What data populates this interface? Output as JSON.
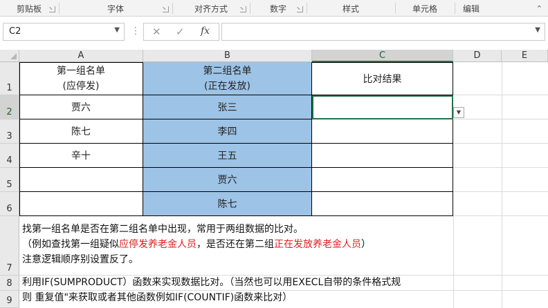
{
  "ribbon": {
    "groups": [
      {
        "label": "剪贴板",
        "launcher": true
      },
      {
        "label": "字体",
        "launcher": true
      },
      {
        "label": "对齐方式",
        "launcher": true
      },
      {
        "label": "数字",
        "launcher": true
      },
      {
        "label": "样式",
        "launcher": false
      },
      {
        "label": "单元格",
        "launcher": false
      },
      {
        "label": "编辑",
        "launcher": false
      }
    ],
    "collapse_icon": "chevron-up-icon"
  },
  "formula_bar": {
    "name_box": "C2",
    "cancel_glyph": "✕",
    "enter_glyph": "✓",
    "fx_glyph": "fx",
    "formula_value": ""
  },
  "sheet": {
    "columns": [
      "A",
      "B",
      "C",
      "D",
      "E"
    ],
    "selected_column": "C",
    "selected_row": "2",
    "rows": [
      "1",
      "2",
      "3",
      "4",
      "5",
      "6",
      "7",
      "8",
      "9"
    ],
    "header": {
      "a_line1": "第一组名单",
      "a_line2": "(应停发)",
      "b_line1": "第二组名单",
      "b_line2": "(正在发放)",
      "c": "比对结果"
    },
    "col_a_values": [
      "贾六",
      "陈七",
      "辛十",
      "",
      ""
    ],
    "col_b_values": [
      "张三",
      "李四",
      "王五",
      "贾六",
      "陈七"
    ],
    "col_c_values": [
      "",
      "",
      "",
      "",
      ""
    ],
    "blue_fill": "#9dc3e6",
    "accent": "#217346"
  },
  "notes": {
    "row7_line1": "找第一组名单是否在第二组名单中出现，常用于两组数据的比对。",
    "row7_line2_a": "（例如查找第一组疑似",
    "row7_line2_b": "应停发养老金人员",
    "row7_line2_c": "，是否还在第二组",
    "row7_line2_d": "正在发放养老金人员",
    "row7_line2_e": "）",
    "row7_line3": "注意逻辑顺序别设置反了。",
    "row8": "利用IF(SUMPRODUCT）函数来实现数据比对。（当然也可以用EXECL自带的条件格式规",
    "row9": "则 重复值\"来获取或者其他函数例如IF(COUNTIF)函数来比对）",
    "red_color": "#e02020"
  }
}
